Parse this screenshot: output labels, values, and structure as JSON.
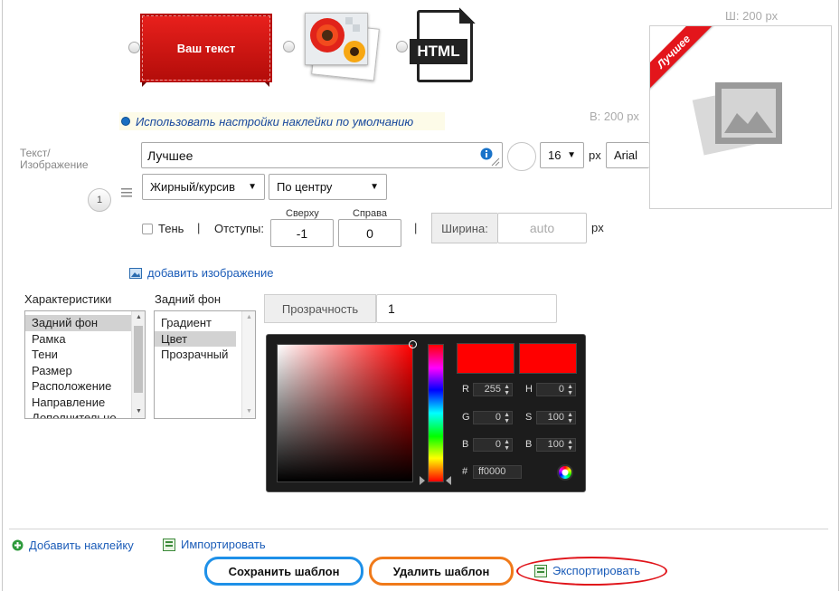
{
  "sticker_types": {
    "text_sticker_label": "Ваш текст",
    "html_label": "HTML"
  },
  "preview": {
    "width_hint": "Ш: 200 px",
    "height_hint": "В: 200 px",
    "ribbon_text": "Лучшее"
  },
  "defaults_option": {
    "label": "Использовать настройки наклейки по умолчанию"
  },
  "text_section": {
    "label_line1": "Текст/",
    "label_line2": "Изображение",
    "text_value": "Лучшее",
    "font_size": "16",
    "font_size_unit": "px",
    "font_family": "Arial",
    "font_style": "Жирный/курсив",
    "alignment": "По центру",
    "layer_number": "1",
    "shadow_label": "Тень",
    "separator": "|",
    "padding_label": "Отступы:",
    "padding_top_label": "Сверху",
    "padding_top_value": "-1",
    "padding_right_label": "Справа",
    "padding_right_value": "0",
    "width_label": "Ширина:",
    "width_placeholder": "auto",
    "width_unit": "px"
  },
  "add_image": {
    "label": "добавить изображение"
  },
  "properties": {
    "header": "Характеристики",
    "items": [
      "Задний фон",
      "Рамка",
      "Тени",
      "Размер",
      "Расположение",
      "Направление",
      "Дополнительно"
    ],
    "selected": "Задний фон"
  },
  "background": {
    "header": "Задний фон",
    "items": [
      "Градиент",
      "Цвет",
      "Прозрачный"
    ],
    "selected": "Цвет"
  },
  "opacity": {
    "label": "Прозрачность",
    "value": "1"
  },
  "color_picker": {
    "current_color": "#ff0000",
    "previous_color": "#ff0000",
    "r_label": "R",
    "r_value": "255",
    "g_label": "G",
    "g_value": "0",
    "b_label": "B",
    "b_value": "0",
    "h_label": "H",
    "h_value": "0",
    "s_label": "S",
    "s_value": "100",
    "br_label": "B",
    "br_value": "100",
    "hex_label": "#",
    "hex_value": "ff0000"
  },
  "footer": {
    "add_sticker": "Добавить наклейку",
    "import": "Импортировать",
    "save_template": "Сохранить шаблон",
    "delete_template": "Удалить шаблон",
    "export": "Экспортировать"
  },
  "colors": {
    "accent_blue": "#1b5cb8",
    "save_outline": "#1e90e8",
    "delete_outline": "#f07a1a",
    "export_highlight": "#e0141a",
    "sticker_red": "#d21411"
  }
}
